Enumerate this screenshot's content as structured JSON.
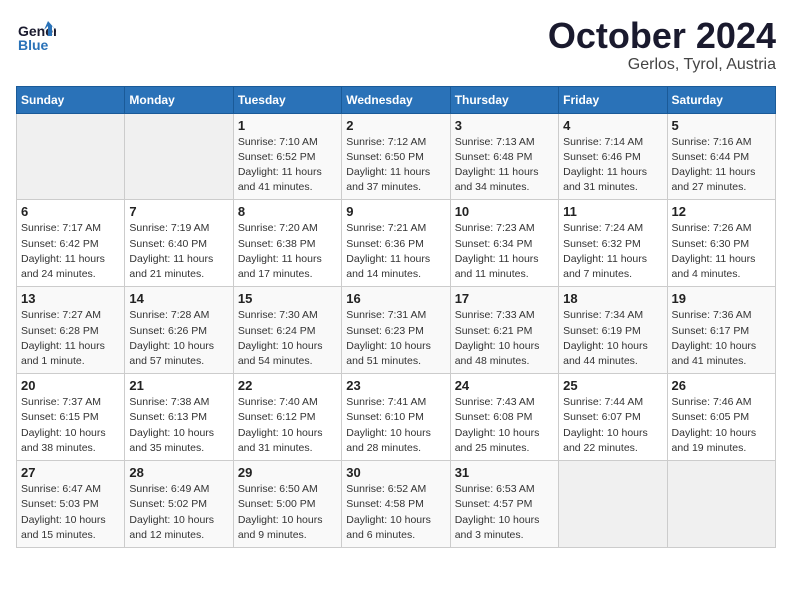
{
  "logo": {
    "line1": "General",
    "line2": "Blue"
  },
  "title": "October 2024",
  "location": "Gerlos, Tyrol, Austria",
  "headers": [
    "Sunday",
    "Monday",
    "Tuesday",
    "Wednesday",
    "Thursday",
    "Friday",
    "Saturday"
  ],
  "weeks": [
    [
      {
        "day": "",
        "sunrise": "",
        "sunset": "",
        "daylight": ""
      },
      {
        "day": "",
        "sunrise": "",
        "sunset": "",
        "daylight": ""
      },
      {
        "day": "1",
        "sunrise": "Sunrise: 7:10 AM",
        "sunset": "Sunset: 6:52 PM",
        "daylight": "Daylight: 11 hours and 41 minutes."
      },
      {
        "day": "2",
        "sunrise": "Sunrise: 7:12 AM",
        "sunset": "Sunset: 6:50 PM",
        "daylight": "Daylight: 11 hours and 37 minutes."
      },
      {
        "day": "3",
        "sunrise": "Sunrise: 7:13 AM",
        "sunset": "Sunset: 6:48 PM",
        "daylight": "Daylight: 11 hours and 34 minutes."
      },
      {
        "day": "4",
        "sunrise": "Sunrise: 7:14 AM",
        "sunset": "Sunset: 6:46 PM",
        "daylight": "Daylight: 11 hours and 31 minutes."
      },
      {
        "day": "5",
        "sunrise": "Sunrise: 7:16 AM",
        "sunset": "Sunset: 6:44 PM",
        "daylight": "Daylight: 11 hours and 27 minutes."
      }
    ],
    [
      {
        "day": "6",
        "sunrise": "Sunrise: 7:17 AM",
        "sunset": "Sunset: 6:42 PM",
        "daylight": "Daylight: 11 hours and 24 minutes."
      },
      {
        "day": "7",
        "sunrise": "Sunrise: 7:19 AM",
        "sunset": "Sunset: 6:40 PM",
        "daylight": "Daylight: 11 hours and 21 minutes."
      },
      {
        "day": "8",
        "sunrise": "Sunrise: 7:20 AM",
        "sunset": "Sunset: 6:38 PM",
        "daylight": "Daylight: 11 hours and 17 minutes."
      },
      {
        "day": "9",
        "sunrise": "Sunrise: 7:21 AM",
        "sunset": "Sunset: 6:36 PM",
        "daylight": "Daylight: 11 hours and 14 minutes."
      },
      {
        "day": "10",
        "sunrise": "Sunrise: 7:23 AM",
        "sunset": "Sunset: 6:34 PM",
        "daylight": "Daylight: 11 hours and 11 minutes."
      },
      {
        "day": "11",
        "sunrise": "Sunrise: 7:24 AM",
        "sunset": "Sunset: 6:32 PM",
        "daylight": "Daylight: 11 hours and 7 minutes."
      },
      {
        "day": "12",
        "sunrise": "Sunrise: 7:26 AM",
        "sunset": "Sunset: 6:30 PM",
        "daylight": "Daylight: 11 hours and 4 minutes."
      }
    ],
    [
      {
        "day": "13",
        "sunrise": "Sunrise: 7:27 AM",
        "sunset": "Sunset: 6:28 PM",
        "daylight": "Daylight: 11 hours and 1 minute."
      },
      {
        "day": "14",
        "sunrise": "Sunrise: 7:28 AM",
        "sunset": "Sunset: 6:26 PM",
        "daylight": "Daylight: 10 hours and 57 minutes."
      },
      {
        "day": "15",
        "sunrise": "Sunrise: 7:30 AM",
        "sunset": "Sunset: 6:24 PM",
        "daylight": "Daylight: 10 hours and 54 minutes."
      },
      {
        "day": "16",
        "sunrise": "Sunrise: 7:31 AM",
        "sunset": "Sunset: 6:23 PM",
        "daylight": "Daylight: 10 hours and 51 minutes."
      },
      {
        "day": "17",
        "sunrise": "Sunrise: 7:33 AM",
        "sunset": "Sunset: 6:21 PM",
        "daylight": "Daylight: 10 hours and 48 minutes."
      },
      {
        "day": "18",
        "sunrise": "Sunrise: 7:34 AM",
        "sunset": "Sunset: 6:19 PM",
        "daylight": "Daylight: 10 hours and 44 minutes."
      },
      {
        "day": "19",
        "sunrise": "Sunrise: 7:36 AM",
        "sunset": "Sunset: 6:17 PM",
        "daylight": "Daylight: 10 hours and 41 minutes."
      }
    ],
    [
      {
        "day": "20",
        "sunrise": "Sunrise: 7:37 AM",
        "sunset": "Sunset: 6:15 PM",
        "daylight": "Daylight: 10 hours and 38 minutes."
      },
      {
        "day": "21",
        "sunrise": "Sunrise: 7:38 AM",
        "sunset": "Sunset: 6:13 PM",
        "daylight": "Daylight: 10 hours and 35 minutes."
      },
      {
        "day": "22",
        "sunrise": "Sunrise: 7:40 AM",
        "sunset": "Sunset: 6:12 PM",
        "daylight": "Daylight: 10 hours and 31 minutes."
      },
      {
        "day": "23",
        "sunrise": "Sunrise: 7:41 AM",
        "sunset": "Sunset: 6:10 PM",
        "daylight": "Daylight: 10 hours and 28 minutes."
      },
      {
        "day": "24",
        "sunrise": "Sunrise: 7:43 AM",
        "sunset": "Sunset: 6:08 PM",
        "daylight": "Daylight: 10 hours and 25 minutes."
      },
      {
        "day": "25",
        "sunrise": "Sunrise: 7:44 AM",
        "sunset": "Sunset: 6:07 PM",
        "daylight": "Daylight: 10 hours and 22 minutes."
      },
      {
        "day": "26",
        "sunrise": "Sunrise: 7:46 AM",
        "sunset": "Sunset: 6:05 PM",
        "daylight": "Daylight: 10 hours and 19 minutes."
      }
    ],
    [
      {
        "day": "27",
        "sunrise": "Sunrise: 6:47 AM",
        "sunset": "Sunset: 5:03 PM",
        "daylight": "Daylight: 10 hours and 15 minutes."
      },
      {
        "day": "28",
        "sunrise": "Sunrise: 6:49 AM",
        "sunset": "Sunset: 5:02 PM",
        "daylight": "Daylight: 10 hours and 12 minutes."
      },
      {
        "day": "29",
        "sunrise": "Sunrise: 6:50 AM",
        "sunset": "Sunset: 5:00 PM",
        "daylight": "Daylight: 10 hours and 9 minutes."
      },
      {
        "day": "30",
        "sunrise": "Sunrise: 6:52 AM",
        "sunset": "Sunset: 4:58 PM",
        "daylight": "Daylight: 10 hours and 6 minutes."
      },
      {
        "day": "31",
        "sunrise": "Sunrise: 6:53 AM",
        "sunset": "Sunset: 4:57 PM",
        "daylight": "Daylight: 10 hours and 3 minutes."
      },
      {
        "day": "",
        "sunrise": "",
        "sunset": "",
        "daylight": ""
      },
      {
        "day": "",
        "sunrise": "",
        "sunset": "",
        "daylight": ""
      }
    ]
  ]
}
